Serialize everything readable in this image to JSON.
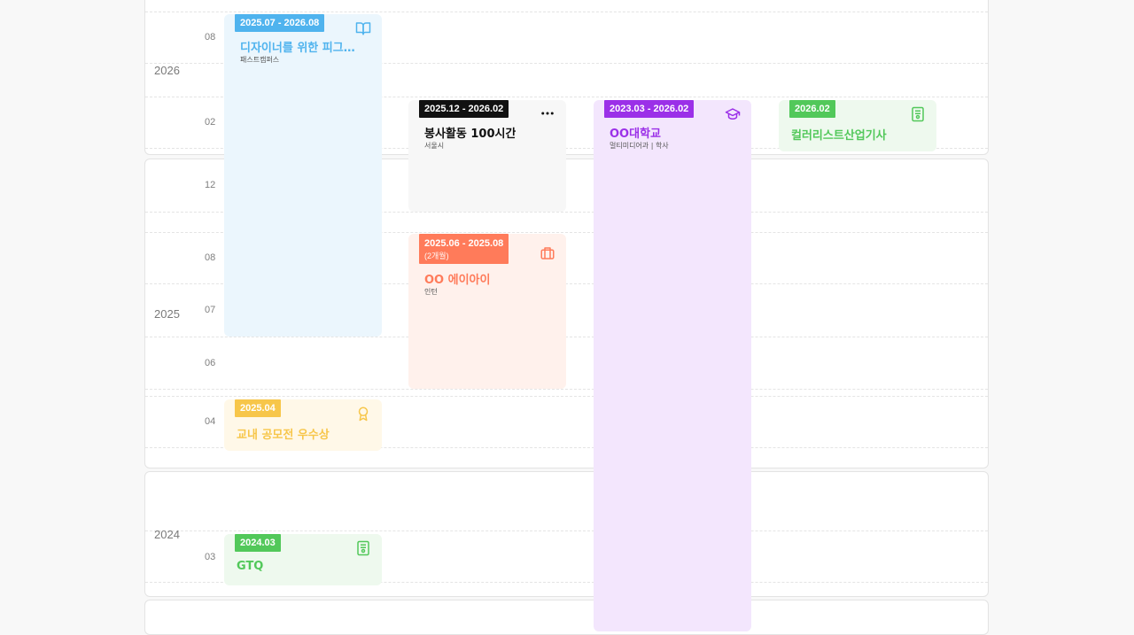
{
  "years": {
    "y2026": "2026",
    "y2025": "2025",
    "y2024": "2024"
  },
  "months": {
    "m2026_08": "08",
    "m2026_02": "02",
    "m2025_12": "12",
    "m2025_08": "08",
    "m2025_07": "07",
    "m2025_06": "06",
    "m2025_04": "04",
    "m2024_03": "03"
  },
  "cards": {
    "course": {
      "date": "2025.07 - 2026.08",
      "title": "디자이너를 위한 피그마 ...",
      "subtitle": "패스트캠퍼스",
      "icon": "book-open-icon"
    },
    "volunteer": {
      "date": "2025.12 - 2026.02",
      "title": "봉사활동 100시간",
      "subtitle": "서울시",
      "icon": "more-horizontal-icon"
    },
    "university": {
      "date": "2023.03 - 2026.02",
      "title": "OO대학교",
      "subtitle": "멀티미디어과 | 학사",
      "icon": "graduation-cap-icon"
    },
    "cert_color": {
      "date": "2026.02",
      "title": "컬러리스트산업기사",
      "icon": "certificate-icon"
    },
    "intern": {
      "date": "2025.06 - 2025.08",
      "duration": "(2개월)",
      "title": "OO 에이아이",
      "subtitle": "인턴",
      "icon": "briefcase-icon"
    },
    "award": {
      "date": "2025.04",
      "title": "교내 공모전 우수상",
      "icon": "award-icon"
    },
    "gtq": {
      "date": "2024.03",
      "title": "GTQ",
      "icon": "certificate-icon"
    }
  },
  "colors": {
    "course": "#4fb3ee",
    "volunteer": "#111111",
    "university": "#9b30e8",
    "cert": "#52c85a",
    "intern": "#ff7b5a",
    "award": "#f7c64a"
  }
}
